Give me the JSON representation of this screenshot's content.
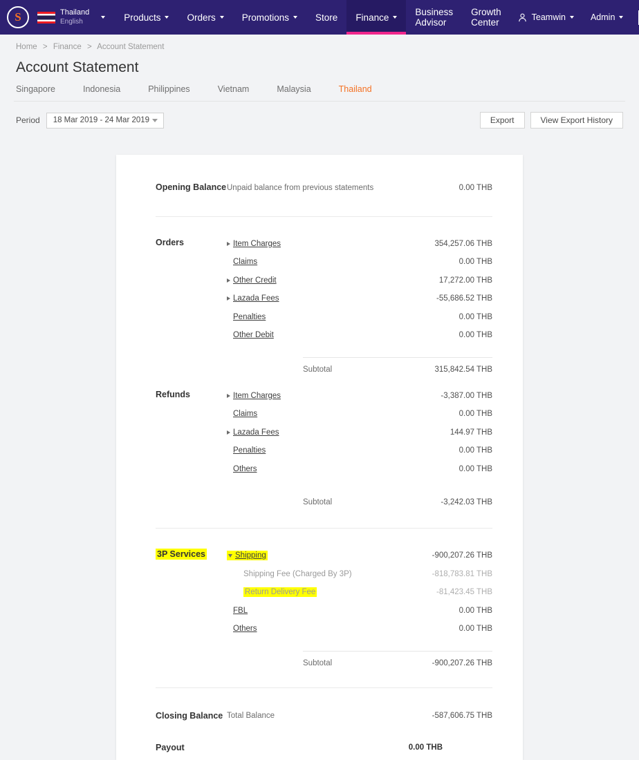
{
  "nav": {
    "logo_alt": "seller-center-logo",
    "country": "Thailand",
    "language": "English",
    "items": [
      {
        "label": "Products",
        "caret": true,
        "active": false
      },
      {
        "label": "Orders",
        "caret": true,
        "active": false
      },
      {
        "label": "Promotions",
        "caret": true,
        "active": false
      },
      {
        "label": "Store",
        "caret": false,
        "active": false
      },
      {
        "label": "Finance",
        "caret": true,
        "active": true
      },
      {
        "label": "Business Advisor",
        "caret": false,
        "active": false
      },
      {
        "label": "Growth Center",
        "caret": false,
        "active": false
      }
    ],
    "user": "Teamwin",
    "admin": "Admin",
    "accent_active": "#f0268c",
    "bar_color": "#2e2172"
  },
  "breadcrumb": {
    "home": "Home",
    "finance": "Finance",
    "current": "Account Statement",
    "separator": ">"
  },
  "header": {
    "title": "Account Statement"
  },
  "country_tabs": [
    {
      "label": "Singapore",
      "active": false
    },
    {
      "label": "Indonesia",
      "active": false
    },
    {
      "label": "Philippines",
      "active": false
    },
    {
      "label": "Vietnam",
      "active": false
    },
    {
      "label": "Malaysia",
      "active": false
    },
    {
      "label": "Thailand",
      "active": true
    }
  ],
  "toolbar": {
    "period_label": "Period",
    "period_value": "18 Mar 2019 - 24 Mar 2019",
    "export_label": "Export",
    "view_export_history_label": "View Export History",
    "active_tab_color": "#f57224"
  },
  "statement": {
    "opening": {
      "head": "Opening Balance",
      "desc": "Unpaid balance from previous statements",
      "amount": "0.00 THB"
    },
    "orders": {
      "head": "Orders",
      "rows": [
        {
          "label": "Item Charges",
          "amount": "354,257.06 THB",
          "expandable": true,
          "expanded": false
        },
        {
          "label": "Claims",
          "amount": "0.00 THB",
          "expandable": false,
          "expanded": false
        },
        {
          "label": "Other Credit",
          "amount": "17,272.00 THB",
          "expandable": true,
          "expanded": false
        },
        {
          "label": "Lazada Fees",
          "amount": "-55,686.52 THB",
          "expandable": true,
          "expanded": false
        },
        {
          "label": "Penalties",
          "amount": "0.00 THB",
          "expandable": false,
          "expanded": false
        },
        {
          "label": "Other Debit",
          "amount": "0.00 THB",
          "expandable": false,
          "expanded": false
        }
      ],
      "subtotal_label": "Subtotal",
      "subtotal_amount": "315,842.54 THB"
    },
    "refunds": {
      "head": "Refunds",
      "rows": [
        {
          "label": "Item Charges",
          "amount": "-3,387.00 THB",
          "expandable": true,
          "expanded": false
        },
        {
          "label": "Claims",
          "amount": "0.00 THB",
          "expandable": false,
          "expanded": false
        },
        {
          "label": "Lazada Fees",
          "amount": "144.97 THB",
          "expandable": true,
          "expanded": false
        },
        {
          "label": "Penalties",
          "amount": "0.00 THB",
          "expandable": false,
          "expanded": false
        },
        {
          "label": "Others",
          "amount": "0.00 THB",
          "expandable": false,
          "expanded": false
        }
      ],
      "subtotal_label": "Subtotal",
      "subtotal_amount": "-3,242.03 THB"
    },
    "services3p": {
      "head": "3P Services",
      "head_highlighted": true,
      "rows": [
        {
          "label": "Shipping",
          "amount": "-900,207.26 THB",
          "expandable": true,
          "expanded": true,
          "highlighted": true
        },
        {
          "label": "Shipping Fee (Charged By 3P)",
          "amount": "-818,783.81 THB",
          "sub": true,
          "muted": true,
          "highlighted": false
        },
        {
          "label": "Return Delivery Fee",
          "amount": "-81,423.45 THB",
          "sub": true,
          "muted": true,
          "highlighted": true
        },
        {
          "label": "FBL",
          "amount": "0.00 THB",
          "expandable": false,
          "expanded": false
        },
        {
          "label": "Others",
          "amount": "0.00 THB",
          "expandable": false,
          "expanded": false
        }
      ],
      "subtotal_label": "Subtotal",
      "subtotal_amount": "-900,207.26 THB"
    },
    "closing": {
      "head": "Closing Balance",
      "desc": "Total Balance",
      "amount": "-587,606.75 THB"
    },
    "payout": {
      "head": "Payout",
      "amount": "0.00 THB"
    },
    "highlight_color": "#ffff00"
  }
}
